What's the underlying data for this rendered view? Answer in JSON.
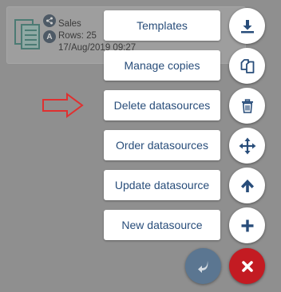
{
  "card": {
    "title": "Sales",
    "rows": "Rows: 25",
    "date": "17/Aug/2019 09:27",
    "badge_letter": "A"
  },
  "menu": {
    "templates": "Templates",
    "manage_copies": "Manage copies",
    "delete_datasources": "Delete datasources",
    "order_datasources": "Order datasources",
    "update_datasource": "Update datasource",
    "new_datasource": "New datasource"
  },
  "colors": {
    "accent": "#284d7a",
    "close": "#c31b22",
    "back": "#5b7691",
    "hint_arrow": "#e03030"
  },
  "icons": {
    "templates": "download-icon",
    "manage_copies": "copy-icon",
    "delete_datasources": "trash-icon",
    "order_datasources": "move-arrows-icon",
    "update_datasource": "arrow-up-icon",
    "new_datasource": "plus-icon",
    "back": "back-arrow-icon",
    "close": "close-icon"
  }
}
